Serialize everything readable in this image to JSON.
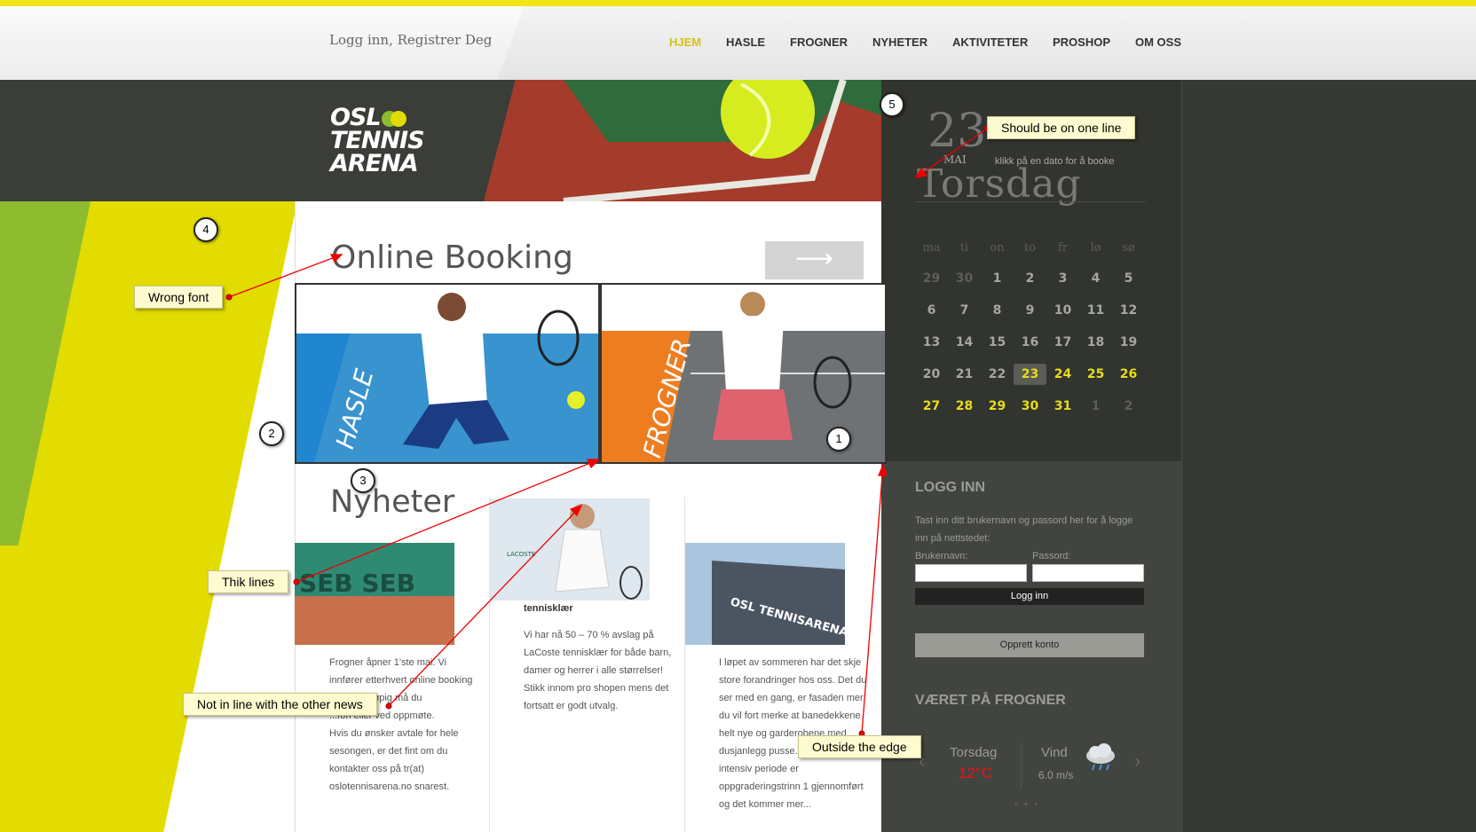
{
  "header": {
    "login_link": "Logg inn, Registrer Deg",
    "nav": [
      "HJEM",
      "HASLE",
      "FROGNER",
      "NYHETER",
      "AKTIVITETER",
      "PROSHOP",
      "OM OSS"
    ],
    "nav_active_color": "#d4c21a"
  },
  "logo": {
    "line1": "OSL",
    "line2": "TENNIS",
    "line3": "ARENA"
  },
  "booking": {
    "title": "Online Booking",
    "arrow": "⟶"
  },
  "tiles": {
    "hasle": "HASLE",
    "frogner": "FROGNER"
  },
  "news": {
    "title": "Nyheter",
    "items": [
      {
        "heading": "",
        "lines": [
          "Frogner åpner 1'ste mai. Vi",
          "innfører etterhvert online booking",
          "...er. Foreløpig må du",
          "...fon eller ved oppmøte.",
          "Hvis du ønsker avtale for hele",
          "sesongen, er det fint om du",
          "kontakter oss på tr(at)",
          "oslotennisarena.no snarest."
        ]
      },
      {
        "heading": "tennisklær",
        "lines": [
          "Vi har nå 50 – 70 % avslag på",
          "LaCoste tennisklær for både barn,",
          "damer og herrer i alle størrelser!",
          "Stikk innom pro shopen mens det",
          "fortsatt er godt utvalg."
        ]
      },
      {
        "heading": "",
        "lines": [
          "I løpet av sommeren har det skje",
          "store forandringer hos oss. Det du",
          "ser med en gang, er fasaden mer",
          "du vil fort merke at banedekkene",
          "helt nye og garderobene med",
          "dusjanlegg pusse...",
          "intensiv periode er",
          "oppgraderingstrinn 1 gjennomført",
          "og det kommer mer..."
        ]
      }
    ]
  },
  "calendar": {
    "day_number": "23",
    "month": "MAI",
    "hint": "klikk på en dato for å booke",
    "weekday": "Torsdag",
    "headers": [
      "ma",
      "ti",
      "on",
      "to",
      "fr",
      "lø",
      "sø"
    ],
    "weeks": [
      [
        "29",
        "30",
        "1",
        "2",
        "3",
        "4",
        "5"
      ],
      [
        "6",
        "7",
        "8",
        "9",
        "10",
        "11",
        "12"
      ],
      [
        "13",
        "14",
        "15",
        "16",
        "17",
        "18",
        "19"
      ],
      [
        "20",
        "21",
        "22",
        "23",
        "24",
        "25",
        "26"
      ],
      [
        "27",
        "28",
        "29",
        "30",
        "31",
        "1",
        "2"
      ]
    ],
    "colors": {
      "past": "#a4a6a0",
      "future": "#e8dc1a",
      "outside": "#5c5e58",
      "today_bg": "#5a5c56"
    }
  },
  "login": {
    "title": "LOGG INN",
    "text_line1": "Tast inn ditt brukernavn og passord her for å logge",
    "text_line2": "inn på nettstedet:",
    "username_label": "Brukernavn:",
    "password_label": "Passord:",
    "login_button": "Logg inn",
    "create_button": "Opprett konto"
  },
  "weather": {
    "title": "VÆRET PÅ FROGNER",
    "day": "Torsdag",
    "temp": "12°C",
    "wind_label": "Vind",
    "wind_value": "6.0 m/s",
    "icon": "rain-cloud-icon"
  },
  "annotations": {
    "wrong_font": "Wrong font",
    "thick_lines": "Thik lines",
    "not_in_line": "Not in line with the other news",
    "outside_edge": "Outside the edge",
    "one_line": "Should be on one line",
    "n1": "1",
    "n2": "2",
    "n3": "3",
    "n4": "4",
    "n5": "5"
  }
}
